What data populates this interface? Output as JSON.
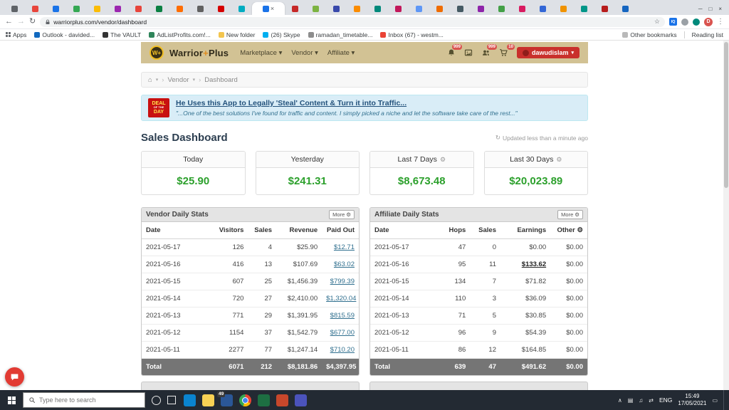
{
  "icons": {
    "back": "←",
    "forward": "→",
    "refresh": "↻",
    "star": "☆",
    "menu": "⋮",
    "minimize": "─",
    "maximize": "□",
    "close": "×",
    "tab_close": "×",
    "home": "⌂",
    "caret_down": "▾",
    "separator": "›",
    "gear": "⚙",
    "caret_up": "∧",
    "monitor": "▤",
    "volume": "♫",
    "network": "⇄",
    "action_center": "▭",
    "avatar_letter": "D",
    "ext_iq": "IQ"
  },
  "browser": {
    "url": "warriorplus.com/vendor/dashboard",
    "active_tab": 12,
    "tabs": [
      "#5f6368",
      "#e8453c",
      "#1a73e8",
      "#34a853",
      "#fbbc05",
      "#9c27b0",
      "#e8453c",
      "#0b8043",
      "#ff6d00",
      "#616161",
      "#d50000",
      "#00acc1",
      "#1a73e8",
      "#c62828",
      "#7cb342",
      "#3949ab",
      "#fb8c00",
      "#00897b",
      "#c2185b",
      "#5e97f6",
      "#ef6c00",
      "#455a64",
      "#8e24aa",
      "#43a047",
      "#d81b60",
      "#3367d6",
      "#f09300",
      "#009688",
      "#b71c1c",
      "#1565c0"
    ],
    "apps_label": "Apps",
    "bookmarks": [
      {
        "label": "Outlook - davided...",
        "color": "#1269bf"
      },
      {
        "label": "The VAULT",
        "color": "#333333"
      },
      {
        "label": "AdListProfits.com!...",
        "color": "#2f855a"
      },
      {
        "label": "New folder",
        "color": "#f3c54e"
      },
      {
        "label": "(26) Skype",
        "color": "#00aff0"
      },
      {
        "label": "ramadan_timetable...",
        "color": "#8d8d8d"
      },
      {
        "label": "Inbox (67) - westm...",
        "color": "#ea4335"
      }
    ],
    "other_bookmarks_label": "Other bookmarks",
    "reading_list_label": "Reading list"
  },
  "header": {
    "brand": {
      "w": "Warrior",
      "plus": "+",
      "p": "Plus"
    },
    "logo_text": "W+",
    "nav": [
      "Marketplace",
      "Vendor",
      "Affiliate"
    ],
    "badges": {
      "bell": "999",
      "users": "999",
      "cart": "10"
    },
    "account": "dawudislam"
  },
  "breadcrumb": {
    "items": [
      "Vendor",
      "Dashboard"
    ]
  },
  "alert": {
    "badge": [
      "DEAL",
      "OF THE",
      "DAY"
    ],
    "title": "He Uses this App to Legally 'Steal' Content & Turn it into Traffic...",
    "quote": "\"...One of the best solutions I've found for traffic and content. I simply picked a niche and let the software take care of the rest...\""
  },
  "dashboard": {
    "title": "Sales Dashboard",
    "updated": "Updated less than a minute ago",
    "cards": [
      {
        "label": "Today",
        "value": "$25.90",
        "gear": false
      },
      {
        "label": "Yesterday",
        "value": "$241.31",
        "gear": false
      },
      {
        "label": "Last 7 Days",
        "value": "$8,673.48",
        "gear": true
      },
      {
        "label": "Last 30 Days",
        "value": "$20,023.89",
        "gear": true
      }
    ]
  },
  "vendor_table": {
    "title": "Vendor Daily Stats",
    "more_label": "More",
    "columns": [
      "Date",
      "Visitors",
      "Sales",
      "Revenue",
      "Paid Out"
    ],
    "col_widths": [
      "30%",
      "19%",
      "13%",
      "21%",
      "17%"
    ],
    "link_col": 4,
    "rows": [
      [
        "2021-05-17",
        "126",
        "4",
        "$25.90",
        "$12.71"
      ],
      [
        "2021-05-16",
        "416",
        "13",
        "$107.69",
        "$63.02"
      ],
      [
        "2021-05-15",
        "607",
        "25",
        "$1,456.39",
        "$799.39"
      ],
      [
        "2021-05-14",
        "720",
        "27",
        "$2,410.00",
        "$1,320.04"
      ],
      [
        "2021-05-13",
        "771",
        "29",
        "$1,391.95",
        "$815.59"
      ],
      [
        "2021-05-12",
        "1154",
        "37",
        "$1,542.79",
        "$677.00"
      ],
      [
        "2021-05-11",
        "2277",
        "77",
        "$1,247.14",
        "$710.20"
      ]
    ],
    "total": [
      "Total",
      "6071",
      "212",
      "$8,181.86",
      "$4,397.95"
    ]
  },
  "affiliate_table": {
    "title": "Affiliate Daily Stats",
    "more_label": "More",
    "columns": [
      "Date",
      "Hops",
      "Sales",
      "Earnings",
      "Other"
    ],
    "col_widths": [
      "30%",
      "16%",
      "14%",
      "23%",
      "17%"
    ],
    "gear_col": 4,
    "link_cells": [
      [
        1,
        3
      ]
    ],
    "rows": [
      [
        "2021-05-17",
        "47",
        "0",
        "$0.00",
        "$0.00"
      ],
      [
        "2021-05-16",
        "95",
        "11",
        "$133.62",
        "$0.00"
      ],
      [
        "2021-05-15",
        "134",
        "7",
        "$71.82",
        "$0.00"
      ],
      [
        "2021-05-14",
        "110",
        "3",
        "$36.09",
        "$0.00"
      ],
      [
        "2021-05-13",
        "71",
        "5",
        "$30.85",
        "$0.00"
      ],
      [
        "2021-05-12",
        "96",
        "9",
        "$54.39",
        "$0.00"
      ],
      [
        "2021-05-11",
        "86",
        "12",
        "$164.85",
        "$0.00"
      ]
    ],
    "total": [
      "Total",
      "639",
      "47",
      "$491.62",
      "$0.00"
    ]
  },
  "taskbar": {
    "search_placeholder": "Type here to search",
    "icons": [
      {
        "name": "edge",
        "color": "#0a84d0"
      },
      {
        "name": "file-explorer",
        "color": "#f7d154"
      },
      {
        "name": "app-store",
        "color": "#2b5797",
        "badge": "49"
      },
      {
        "name": "chrome",
        "color": ""
      },
      {
        "name": "excel",
        "color": "#1d6f42"
      },
      {
        "name": "powerpoint",
        "color": "#c8472b"
      },
      {
        "name": "teams",
        "color": "#4b53bc"
      }
    ],
    "tray": {
      "lang": "ENG",
      "time": "15:49",
      "date": "17/05/2021"
    }
  }
}
